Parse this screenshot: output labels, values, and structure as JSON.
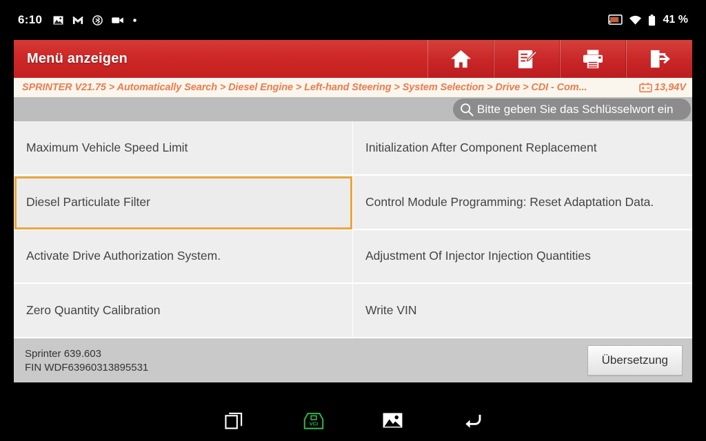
{
  "statusbar": {
    "clock": "6:10",
    "left_icons": [
      "image-icon",
      "gmail-icon",
      "bluetooth-icon",
      "video-icon",
      "dot-icon"
    ],
    "right_icons": [
      "cast-icon",
      "wifi-icon",
      "battery-icon"
    ],
    "battery_percent": "41 %"
  },
  "appbar": {
    "title": "Menü anzeigen",
    "actions": [
      {
        "name": "home-button",
        "icon": "home-icon"
      },
      {
        "name": "feedback-button",
        "icon": "edit-document-icon"
      },
      {
        "name": "print-button",
        "icon": "printer-icon"
      },
      {
        "name": "exit-button",
        "icon": "exit-icon"
      }
    ]
  },
  "breadcrumb": {
    "path": "SPRINTER V21.75 > Automatically Search > Diesel Engine > Left-hand Steering > System Selection > Drive > CDI -  Com...",
    "voltage": "13,94V",
    "voltage_icon": "car-battery-icon"
  },
  "search": {
    "icon": "search-icon",
    "placeholder": "Bitte geben Sie das Schlüsselwort ein",
    "value": ""
  },
  "menu": {
    "items": [
      {
        "label": "Maximum Vehicle Speed Limit",
        "selected": false
      },
      {
        "label": "Initialization After Component Replacement",
        "selected": false
      },
      {
        "label": "Diesel Particulate Filter",
        "selected": true
      },
      {
        "label": "Control Module Programming: Reset Adaptation Data.",
        "selected": false
      },
      {
        "label": "Activate Drive Authorization System.",
        "selected": false
      },
      {
        "label": "Adjustment Of Injector Injection Quantities",
        "selected": false
      },
      {
        "label": "Zero Quantity Calibration",
        "selected": false
      },
      {
        "label": "Write VIN",
        "selected": false
      }
    ]
  },
  "infobar": {
    "vehicle": "Sprinter 639.603",
    "fin": "FIN WDF63960313895531",
    "translate_label": "Übersetzung"
  },
  "navbar": {
    "buttons": [
      {
        "name": "recent-apps-button",
        "icon": "recent-apps-icon"
      },
      {
        "name": "vci-button",
        "icon": "vci-connector-icon",
        "label": "VCI"
      },
      {
        "name": "screenshot-button",
        "icon": "image-icon"
      },
      {
        "name": "back-button",
        "icon": "back-arrow-icon"
      }
    ]
  },
  "colors": {
    "accent_red": "#cc2229",
    "breadcrumb_orange": "#ec7c4d",
    "selection_orange": "#e9a63c",
    "vci_green": "#2db24a",
    "cell_bg": "#eeeeee",
    "infobar_bg": "#c9c9c9"
  }
}
